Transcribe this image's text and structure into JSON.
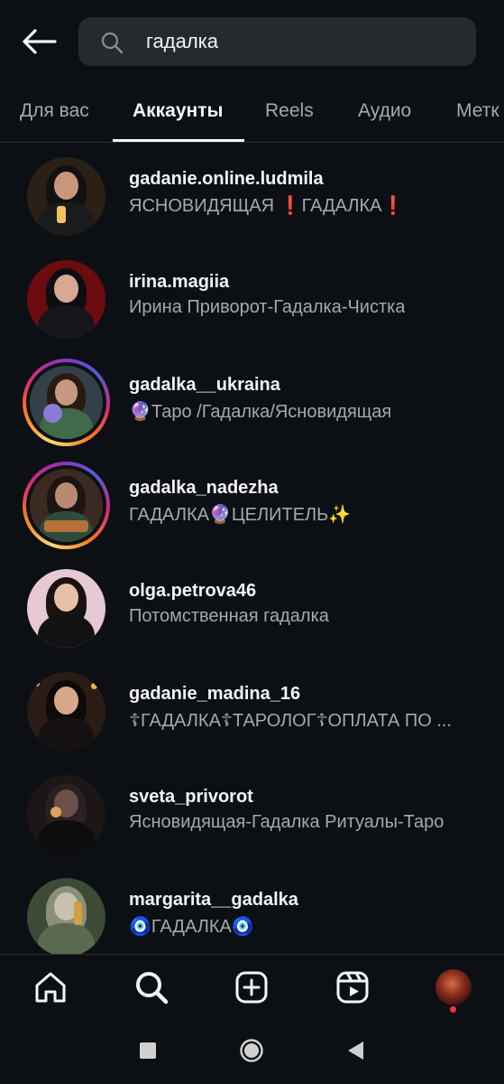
{
  "search": {
    "value": "гадалка",
    "icon": "search-icon"
  },
  "tabs": [
    {
      "label": "Для вас"
    },
    {
      "label": "Аккаунты"
    },
    {
      "label": "Reels"
    },
    {
      "label": "Аудио"
    },
    {
      "label": "Метк"
    }
  ],
  "active_tab": "Аккаунты",
  "accounts": [
    {
      "username": "gadanie.online.ludmila",
      "subtitle": "ЯСНОВИДЯЩАЯ ❗ГАДАЛКА❗",
      "story_ring": false
    },
    {
      "username": "irina.magiia",
      "subtitle": "Ирина Приворот-Гадалка-Чистка",
      "story_ring": false
    },
    {
      "username": "gadalka__ukraina",
      "subtitle": "🔮Таро /Гадалка/Ясновидящая",
      "story_ring": true
    },
    {
      "username": "gadalka_nadezha",
      "subtitle": "ГАДАЛКА🔮ЦЕЛИТЕЛЬ✨",
      "story_ring": true
    },
    {
      "username": "olga.petrova46",
      "subtitle": "Потомственная гадалка",
      "story_ring": false
    },
    {
      "username": "gadanie_madina_16",
      "subtitle": "☦ГАДАЛКА☦ТАРОЛОГ☦ОПЛАТА ПО ...",
      "story_ring": false
    },
    {
      "username": "sveta_privorot",
      "subtitle": "Ясновидящая-Гадалка Ритуалы-Таро",
      "story_ring": false
    },
    {
      "username": "margarita__gadalka",
      "subtitle": "🧿ГАДАЛКА🧿",
      "story_ring": false
    }
  ],
  "bottom_nav": [
    "home-icon",
    "search-icon",
    "create-icon",
    "reels-icon",
    "profile-avatar"
  ],
  "colors": {
    "background": "#0c1014",
    "search_bg": "#262a2f",
    "secondary_text": "#a8a8a8",
    "notification": "#ff3040"
  }
}
